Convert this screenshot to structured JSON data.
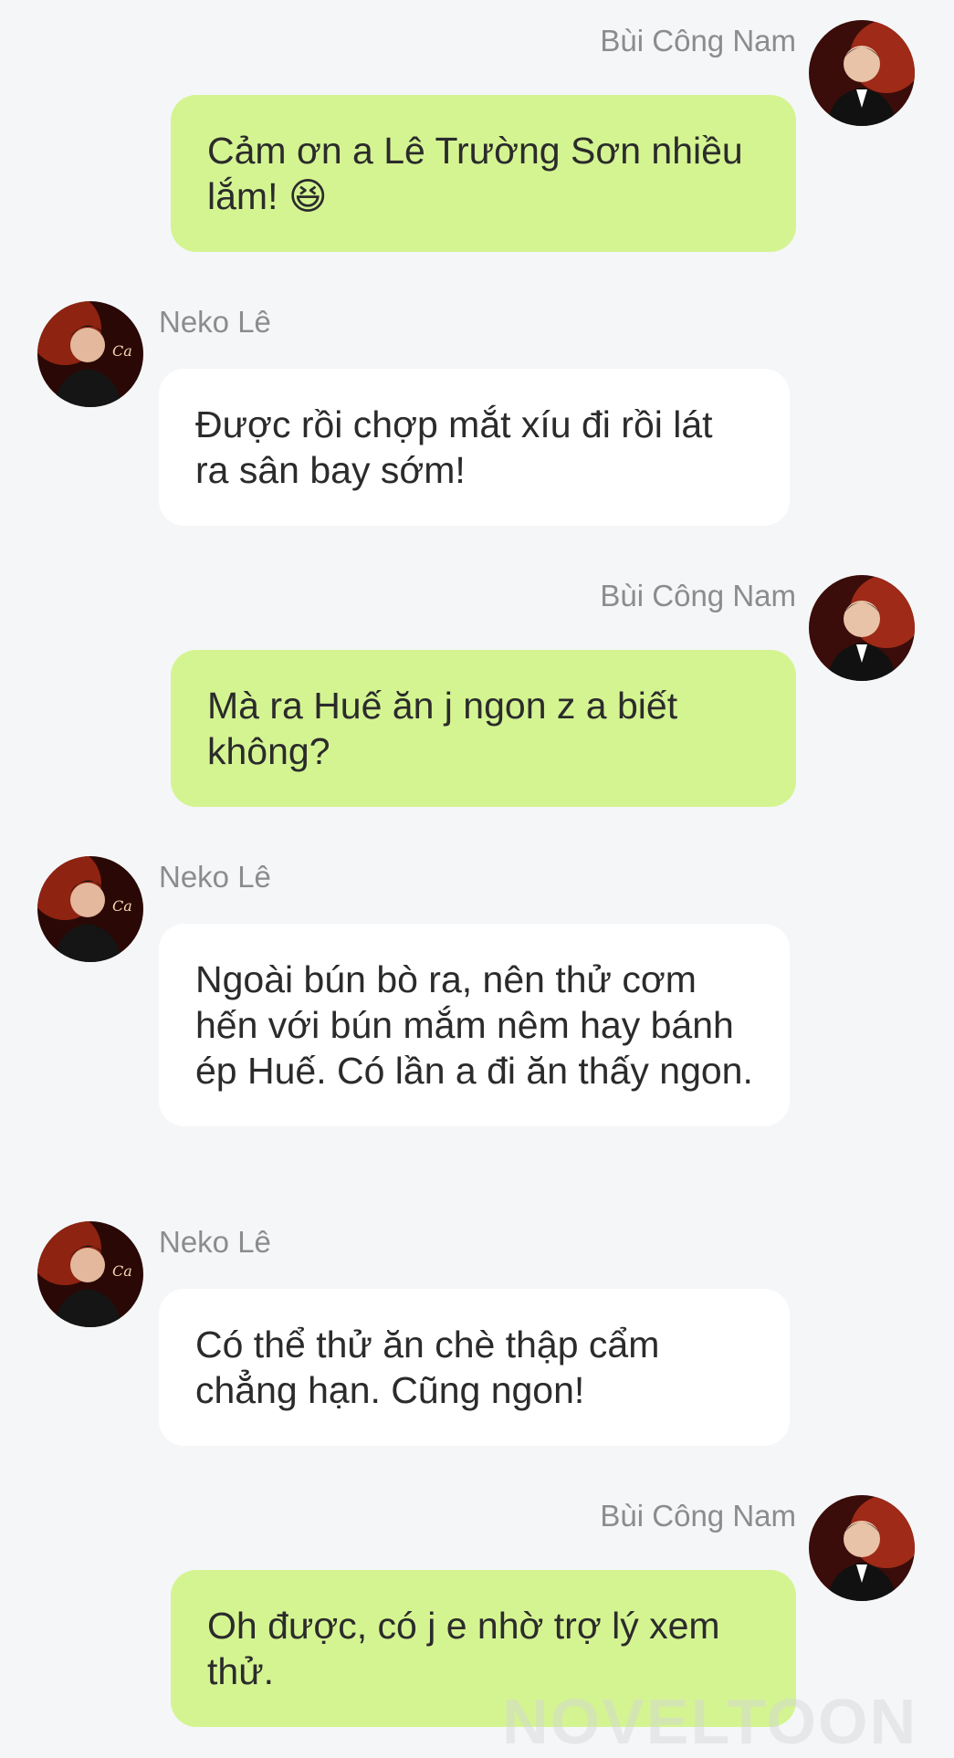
{
  "messages": [
    {
      "side": "right",
      "sender": "Bùi Công Nam",
      "text": "Cảm ơn a Lê Trường Sơn nhiều lắm! 😆"
    },
    {
      "side": "left",
      "sender": "Neko Lê",
      "text": "Được rồi chợp mắt xíu đi rồi lát ra sân bay sớm!"
    },
    {
      "side": "right",
      "sender": "Bùi Công Nam",
      "text": "Mà ra Huế ăn j ngon z a biết không?"
    },
    {
      "side": "left",
      "sender": "Neko Lê",
      "text": "Ngoài bún bò ra, nên thử cơm hến với bún mắm nêm hay bánh ép Huế. Có lần a đi ăn thấy ngon."
    },
    {
      "side": "left",
      "sender": "Neko Lê",
      "text": "Có thể thử ăn chè thập cẩm chẳng hạn. Cũng ngon!"
    },
    {
      "side": "right",
      "sender": "Bùi Công Nam",
      "text": "Oh được, có j e nhờ trợ lý xem thử."
    }
  ],
  "watermark": "NOVELTOON",
  "colors": {
    "right_bubble": "#d4f492",
    "left_bubble": "#ffffff",
    "background": "#f5f6f8",
    "name": "#8c8c8c"
  }
}
